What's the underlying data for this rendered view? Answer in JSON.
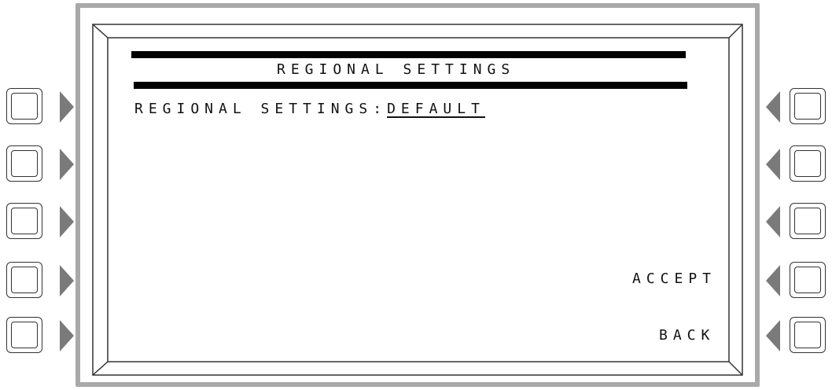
{
  "screen": {
    "title": "REGIONAL SETTINGS",
    "setting_label": "REGIONAL SETTINGS:",
    "setting_value": "DEFAULT",
    "accept_label": "ACCEPT",
    "back_label": "BACK"
  },
  "colors": {
    "bezel": "#a9a9a9",
    "arrow": "#7a7a7a",
    "text": "#111111"
  }
}
